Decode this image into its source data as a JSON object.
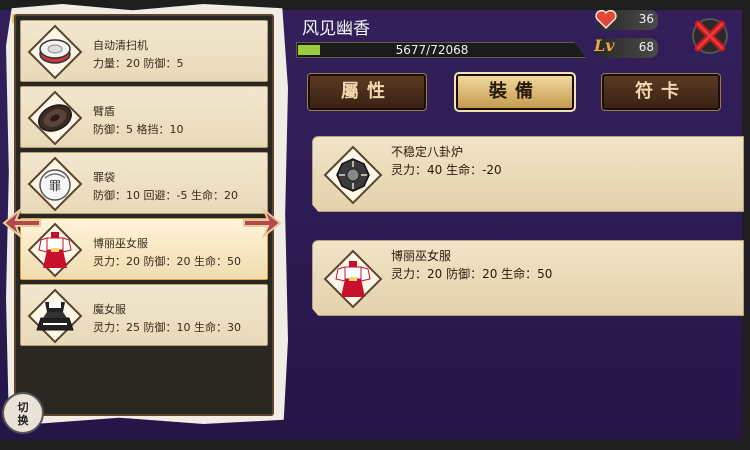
{
  "character": {
    "name": "风见幽香",
    "exp_text": "5677/72068",
    "exp_fraction": 0.079,
    "hp": "36",
    "level": "68",
    "level_badge": "Lv"
  },
  "tabs": [
    {
      "label": "屬性"
    },
    {
      "label": "裝備"
    },
    {
      "label": "符卡"
    }
  ],
  "active_tab": "裝備",
  "items": [
    {
      "name": "自动清扫机",
      "stats": "力量：20 防御：5",
      "icon": "robot-vacuum-icon"
    },
    {
      "name": "臂盾",
      "stats": "防御：5 格挡：10",
      "icon": "arm-shield-icon"
    },
    {
      "name": "罪袋",
      "stats": "防御：10 回避：-5 生命：20",
      "icon": "sin-sack-icon"
    },
    {
      "name": "博丽巫女服",
      "stats": "灵力：20 防御：20 生命：50",
      "icon": "shrine-maiden-outfit-icon"
    },
    {
      "name": "魔女服",
      "stats": "灵力：25 防御：10 生命：30",
      "icon": "witch-outfit-icon"
    }
  ],
  "equipped": [
    {
      "name": "不稳定八卦炉",
      "stats": "灵力：40 生命：-20",
      "icon": "hakkero-icon"
    },
    {
      "name": "博丽巫女服",
      "stats": "灵力：20 防御：20 生命：50",
      "icon": "shrine-maiden-outfit-icon"
    }
  ],
  "swap_button": {
    "label_line1": "切",
    "label_line2": "换"
  },
  "colors": {
    "background": "#2b1b52",
    "card": "#f0e3c7",
    "exp_fill": "#9bcc3a",
    "tab_active": "#f1d9a0",
    "close_x": "#c0181c"
  }
}
